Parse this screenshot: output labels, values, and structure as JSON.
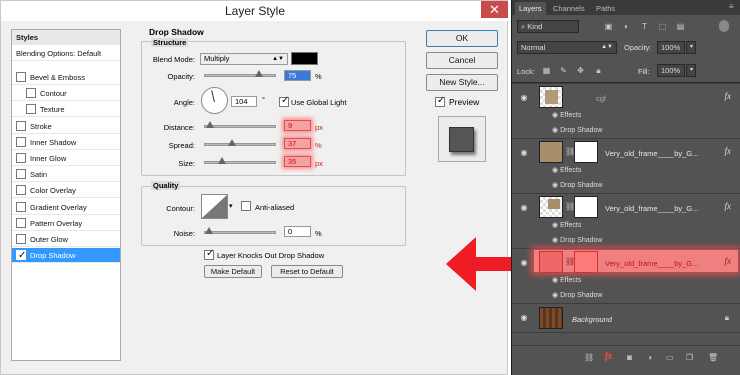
{
  "dialog": {
    "title": "Layer Style",
    "close_glyph": "✕",
    "styles_header": "Styles",
    "blending_options": "Blending Options: Default",
    "effects": [
      {
        "label": "Bevel & Emboss",
        "checked": false,
        "indent": false
      },
      {
        "label": "Contour",
        "checked": false,
        "indent": true
      },
      {
        "label": "Texture",
        "checked": false,
        "indent": true
      },
      {
        "label": "Stroke",
        "checked": false,
        "indent": false
      },
      {
        "label": "Inner Shadow",
        "checked": false,
        "indent": false
      },
      {
        "label": "Inner Glow",
        "checked": false,
        "indent": false
      },
      {
        "label": "Satin",
        "checked": false,
        "indent": false
      },
      {
        "label": "Color Overlay",
        "checked": false,
        "indent": false
      },
      {
        "label": "Gradient Overlay",
        "checked": false,
        "indent": false
      },
      {
        "label": "Pattern Overlay",
        "checked": false,
        "indent": false
      },
      {
        "label": "Outer Glow",
        "checked": false,
        "indent": false
      },
      {
        "label": "Drop Shadow",
        "checked": true,
        "indent": false
      }
    ],
    "section_title": "Drop Shadow",
    "structure_title": "Structure",
    "blend_mode_label": "Blend Mode:",
    "blend_mode_value": "Multiply",
    "shadow_color": "#000000",
    "opacity_label": "Opacity:",
    "opacity_value": "75",
    "percent": "%",
    "angle_label": "Angle:",
    "angle_value": "104",
    "degree": "°",
    "use_global_light": "Use Global Light",
    "distance_label": "Distance:",
    "distance_value": "9",
    "spread_label": "Spread:",
    "spread_value": "37",
    "size_label": "Size:",
    "size_value": "35",
    "px": "px",
    "quality_title": "Quality",
    "contour_label": "Contour:",
    "anti_aliased": "Anti-aliased",
    "noise_label": "Noise:",
    "noise_value": "0",
    "knocks_out": "Layer Knocks Out Drop Shadow",
    "make_default": "Make Default",
    "reset_default": "Reset to Default",
    "ok": "OK",
    "cancel": "Cancel",
    "new_style": "New Style...",
    "preview": "Preview",
    "highlight_color": "#ff4d4d"
  },
  "panel": {
    "tabs": [
      "Layers",
      "Channels",
      "Paths"
    ],
    "kind_label": "Kind",
    "blend_mode": "Normal",
    "opacity_label": "Opacity:",
    "opacity_value": "100%",
    "lock_label": "Lock:",
    "fill_label": "Fill:",
    "fill_value": "100%",
    "layers": [
      {
        "name": "cgf",
        "effects_label": "Effects",
        "effect": "Drop Shadow"
      },
      {
        "name": "Very_old_frame____by_G...",
        "effects_label": "Effects",
        "effect": "Drop Shadow"
      },
      {
        "name": "Very_old_frame____by_G...",
        "effects_label": "Effects",
        "effect": "Drop Shadow"
      },
      {
        "name": "Very_old_frame____by_G...",
        "effects_label": "Effects",
        "effect": "Drop Shadow"
      },
      {
        "name": "Background",
        "effects_label": "",
        "effect": ""
      }
    ],
    "fx_glyph": "fx"
  },
  "arrow_color": "#ee1c24"
}
